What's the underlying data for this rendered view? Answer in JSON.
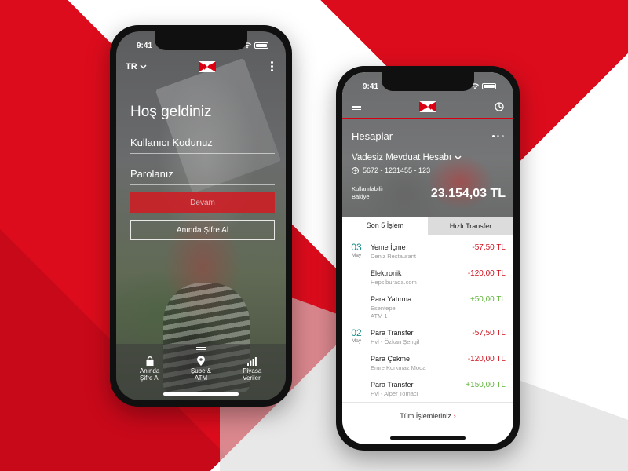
{
  "colors": {
    "brand_red": "#db0011",
    "positive_green": "#60b33a",
    "date_teal": "#178c8a"
  },
  "left_phone": {
    "status": {
      "time": "9:41"
    },
    "top": {
      "language": "TR",
      "language_icon": "chevron-down-icon",
      "menu_icon": "more-vertical-icon",
      "logo": "hexagon-logo"
    },
    "welcome": "Hoş geldiniz",
    "username_placeholder": "Kullanıcı Kodunuz",
    "password_placeholder": "Parolanız",
    "continue_label": "Devam",
    "instant_password_label": "Anında Şifre Al",
    "bottom_nav": [
      {
        "icon": "lock-icon",
        "label_1": "Anında",
        "label_2": "Şifre Al"
      },
      {
        "icon": "location-pin-icon",
        "label_1": "Şube &",
        "label_2": "ATM"
      },
      {
        "icon": "bar-chart-icon",
        "label_1": "Piyasa",
        "label_2": "Verileri"
      }
    ]
  },
  "right_phone": {
    "status": {
      "time": "9:41"
    },
    "nav": {
      "menu_icon": "hamburger-icon",
      "logo": "hexagon-logo",
      "right_icon": "pie-chart-icon"
    },
    "accounts_title": "Hesaplar",
    "account_name": "Vadesiz Mevduat Hesabı",
    "account_number": "5672 - 1231455 - 123",
    "balance_label_1": "Kullanılabilir",
    "balance_label_2": "Bakiye",
    "balance": "23.154,03 TL",
    "tabs": [
      "Son 5 İşlem",
      "Hızlı Transfer"
    ],
    "transactions": [
      {
        "day": "03",
        "month": "May",
        "name": "Yeme İçme",
        "sub_1": "Deniz Restaurant",
        "sub_2": "",
        "amount": "-57,50 TL",
        "sign": "neg"
      },
      {
        "day": "",
        "month": "",
        "name": "Elektronik",
        "sub_1": "Hepsiburada.com",
        "sub_2": "",
        "amount": "-120,00 TL",
        "sign": "neg"
      },
      {
        "day": "",
        "month": "",
        "name": "Para Yatırma",
        "sub_1": "Esentepe",
        "sub_2": "ATM 1",
        "amount": "+50,00 TL",
        "sign": "pos"
      },
      {
        "day": "02",
        "month": "May",
        "name": "Para Transferi",
        "sub_1": "Hvl - Özkan Şengil",
        "sub_2": "",
        "amount": "-57,50 TL",
        "sign": "neg"
      },
      {
        "day": "",
        "month": "",
        "name": "Para Çekme",
        "sub_1": "Emre Korkmaz Moda",
        "sub_2": "",
        "amount": "-120,00 TL",
        "sign": "neg"
      },
      {
        "day": "",
        "month": "",
        "name": "Para Transferi",
        "sub_1": "Hvl - Alper Tomacı",
        "sub_2": "",
        "amount": "+150,00 TL",
        "sign": "pos"
      }
    ],
    "all_transactions_label": "Tüm İşlemleriniz"
  }
}
